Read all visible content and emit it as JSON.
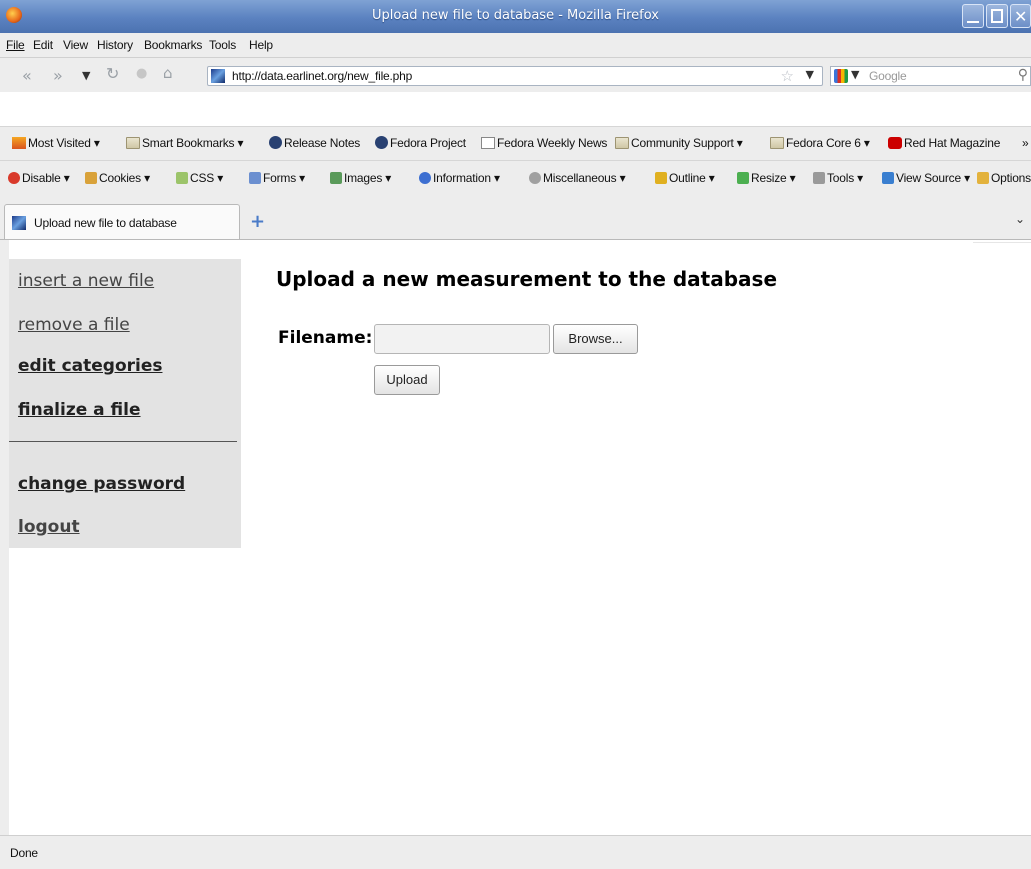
{
  "window": {
    "title": "Upload new file to database - Mozilla Firefox"
  },
  "menu": [
    "File",
    "Edit",
    "View",
    "History",
    "Bookmarks",
    "Tools",
    "Help"
  ],
  "nav": {
    "url": "http://data.earlinet.org/new_file.php",
    "search_placeholder": "Google"
  },
  "bookmarks": [
    {
      "label": "Most Visited",
      "icon": "most-visited-icon",
      "dropdown": true
    },
    {
      "label": "Smart Bookmarks",
      "icon": "folder-icon",
      "dropdown": true
    },
    {
      "label": "Release Notes",
      "icon": "fedora-icon",
      "dropdown": false
    },
    {
      "label": "Fedora Project",
      "icon": "fedora-icon",
      "dropdown": false
    },
    {
      "label": "Fedora Weekly News",
      "icon": "feed-icon",
      "dropdown": false
    },
    {
      "label": "Community Support",
      "icon": "folder-icon",
      "dropdown": true
    },
    {
      "label": "Fedora Core 6",
      "icon": "folder-icon",
      "dropdown": true
    },
    {
      "label": "Red Hat Magazine",
      "icon": "redhat-icon",
      "dropdown": false
    }
  ],
  "bookmarks_overflow": "»",
  "devtools": [
    {
      "label": "Disable",
      "icon": "disable-icon",
      "color": "#d93a2b"
    },
    {
      "label": "Cookies",
      "icon": "cookies-icon",
      "color": "#d9a23a"
    },
    {
      "label": "CSS",
      "icon": "css-icon",
      "color": "#9cc46a"
    },
    {
      "label": "Forms",
      "icon": "forms-icon",
      "color": "#6b8fd0"
    },
    {
      "label": "Images",
      "icon": "images-icon",
      "color": "#5a9a5a"
    },
    {
      "label": "Information",
      "icon": "information-icon",
      "color": "#3d6fd1"
    },
    {
      "label": "Miscellaneous",
      "icon": "miscellaneous-icon",
      "color": "#a0a0a0"
    },
    {
      "label": "Outline",
      "icon": "outline-icon",
      "color": "#e0b020"
    },
    {
      "label": "Resize",
      "icon": "resize-icon",
      "color": "#4caf50"
    },
    {
      "label": "Tools",
      "icon": "tools-icon",
      "color": "#9a9a9a"
    },
    {
      "label": "View Source",
      "icon": "view-source-icon",
      "color": "#3a7fd0"
    },
    {
      "label": "Options",
      "icon": "options-icon",
      "color": "#e3b23c"
    }
  ],
  "tab": {
    "label": "Upload new file to database"
  },
  "sidebar": {
    "items": [
      {
        "label": "insert a new file",
        "style": "gray"
      },
      {
        "label": "remove a file",
        "style": "gray"
      },
      {
        "label": "edit categories",
        "style": "bold"
      },
      {
        "label": "finalize a file",
        "style": "bold"
      },
      {
        "label": "change password",
        "style": "bold"
      },
      {
        "label": "logout",
        "style": "gray"
      }
    ]
  },
  "main": {
    "heading": "Upload a new measurement to the database",
    "filename_label": "Filename:",
    "browse_label": "Browse...",
    "upload_label": "Upload"
  },
  "status": "Done"
}
